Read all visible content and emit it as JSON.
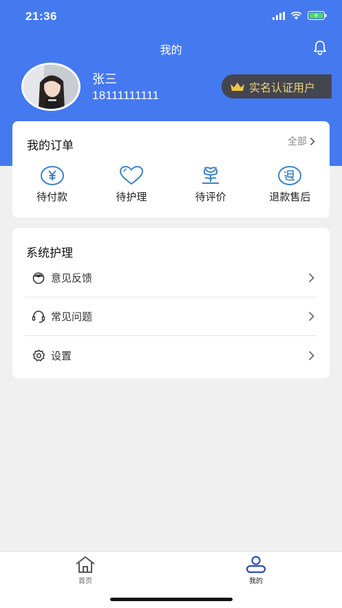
{
  "status_bar": {
    "time": "21:36"
  },
  "header": {
    "title": "我的"
  },
  "profile": {
    "name": "张三",
    "phone": "18111111111",
    "verify_badge": "实名认证用户"
  },
  "orders": {
    "title": "我的订单",
    "all_label": "全部",
    "items": [
      {
        "label": "待付款",
        "icon": "yen-icon"
      },
      {
        "label": "待护理",
        "icon": "heart-icon"
      },
      {
        "label": "待评价",
        "icon": "flower-icon"
      },
      {
        "label": "退款售后",
        "icon": "refund-icon"
      }
    ]
  },
  "system": {
    "title": "系统护理",
    "items": [
      {
        "label": "意见反馈",
        "icon": "feedback-icon"
      },
      {
        "label": "常见问题",
        "icon": "headset-icon"
      },
      {
        "label": "设置",
        "icon": "settings-icon"
      }
    ]
  },
  "tabbar": {
    "items": [
      {
        "label": "首页",
        "icon": "home-icon",
        "active": false
      },
      {
        "label": "我的",
        "icon": "user-icon",
        "active": true
      }
    ]
  },
  "colors": {
    "brand": "#4479f0",
    "icon_blue": "#3d82c4",
    "badge_bg": "#43464f",
    "badge_text": "#f0d27a",
    "tab_active": "#2f4db7",
    "tab_inactive": "#666666"
  }
}
